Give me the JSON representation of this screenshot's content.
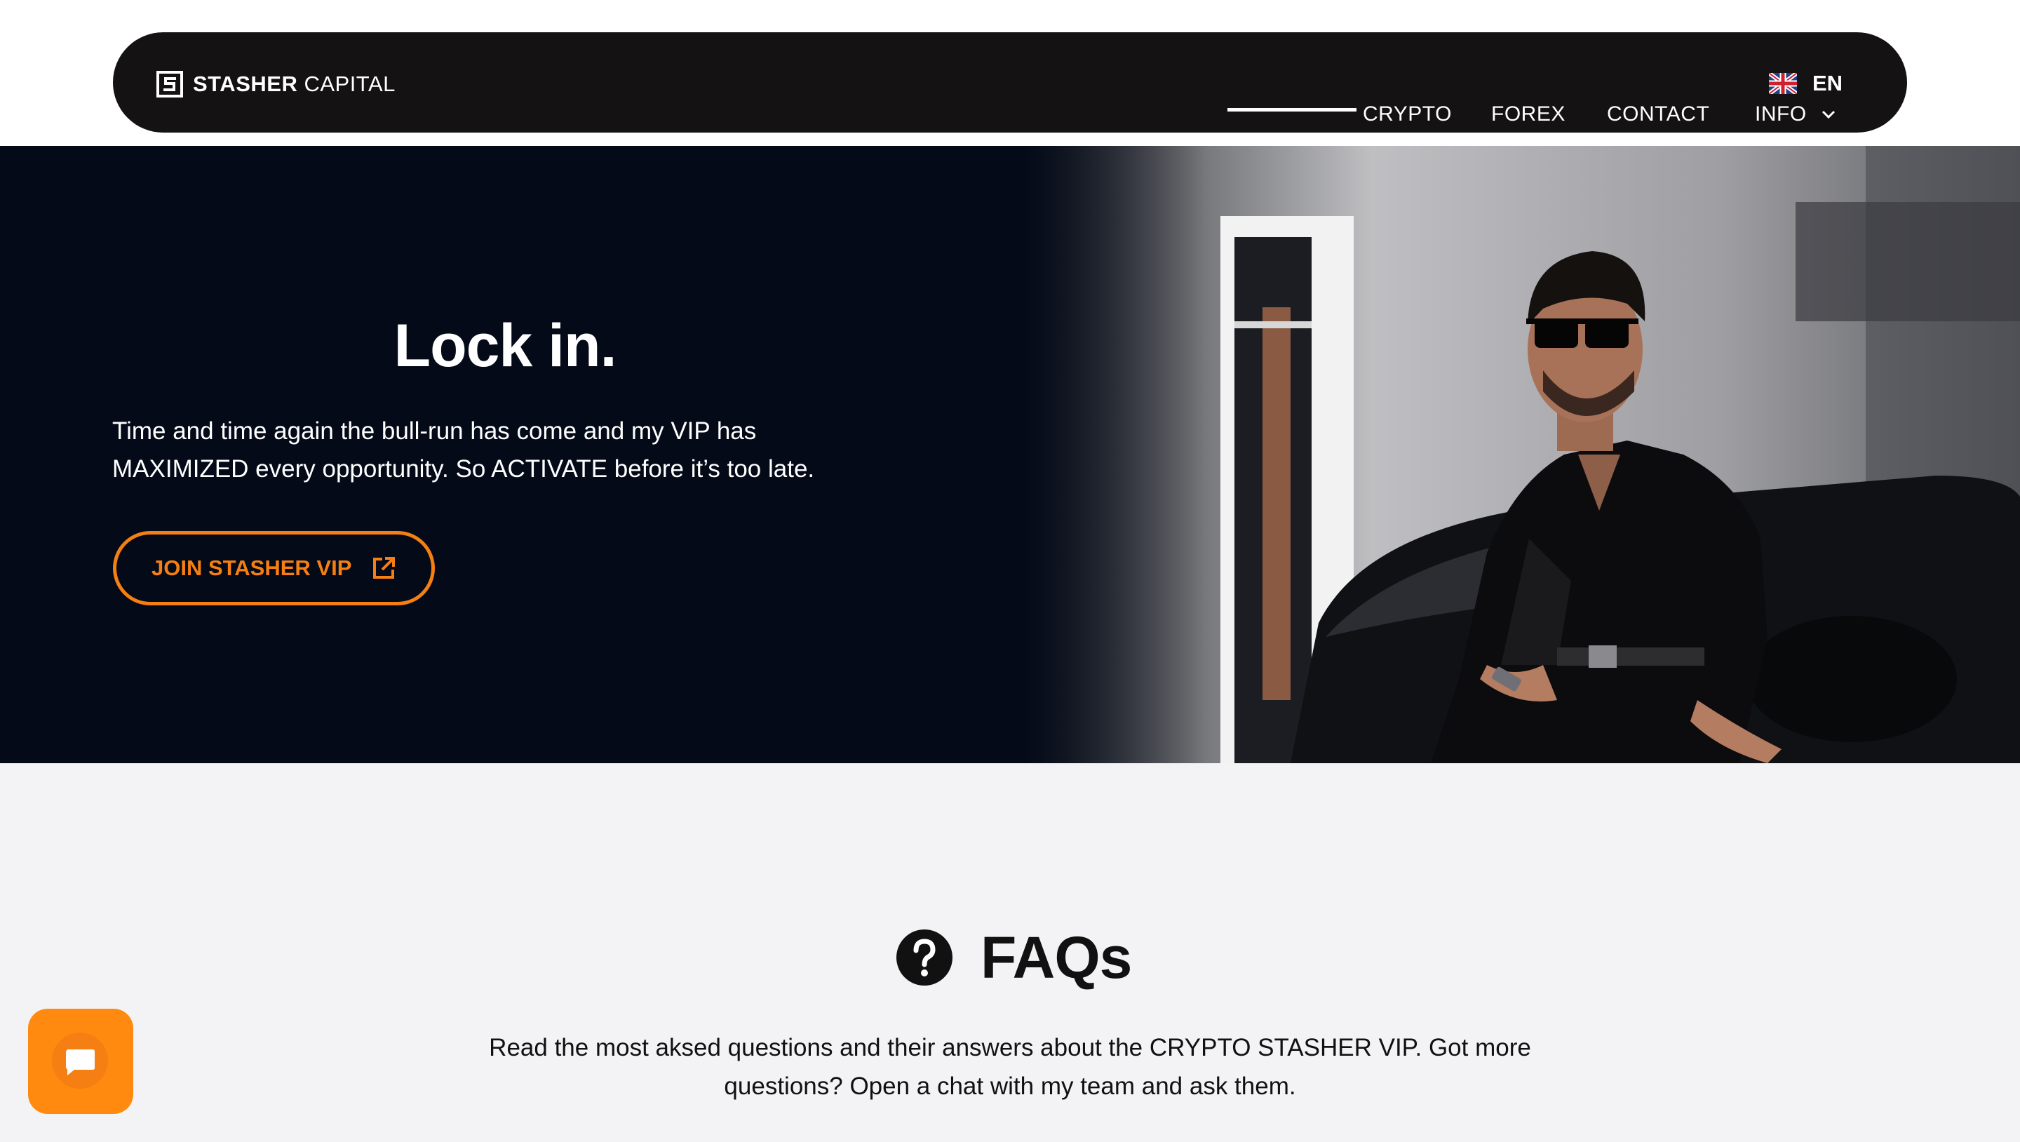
{
  "brand": {
    "name_bold": "STASHER",
    "name_light": "CAPITAL"
  },
  "nav": {
    "items": [
      {
        "label": "CRYPTO",
        "active": true
      },
      {
        "label": "FOREX",
        "active": false
      },
      {
        "label": "CONTACT",
        "active": false
      },
      {
        "label": "INFO",
        "active": false,
        "has_dropdown": true
      }
    ],
    "language": {
      "code": "EN",
      "flag_icon": "uk-flag-icon"
    }
  },
  "hero": {
    "title": "Lock in.",
    "text_line1": "Time and time again the bull-run has come and my VIP has",
    "text_line2": "MAXIMIZED every opportunity. So ACTIVATE before it’s too late.",
    "cta_label": "JOIN STASHER VIP",
    "cta_icon": "external-link-icon"
  },
  "faq": {
    "icon": "question-circle-icon",
    "title": "FAQs",
    "text_line1": "Read the most aksed questions and their answers about the CRYPTO STASHER VIP. Got more",
    "text_line2": "questions? Open a chat with my team and ask them."
  },
  "chat": {
    "icon": "chat-bubble-icon"
  },
  "colors": {
    "nav_bg": "#141213",
    "hero_bg": "#040a18",
    "accent": "#f57f12",
    "page_bg": "#f3f2f4",
    "chat_button": "#ff8a0f"
  }
}
